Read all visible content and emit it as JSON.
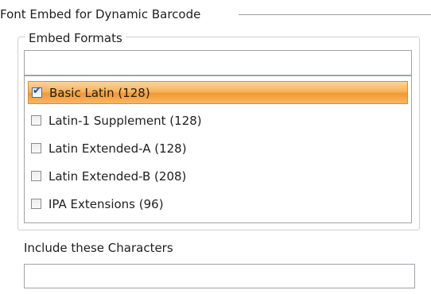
{
  "section": {
    "title": "Font Embed for Dynamic Barcode"
  },
  "embed_formats": {
    "group_title": "Embed Formats",
    "filter_value": "",
    "items": [
      {
        "label": "Basic Latin (128)",
        "checked": true,
        "selected": true
      },
      {
        "label": "Latin-1 Supplement (128)",
        "checked": false,
        "selected": false
      },
      {
        "label": "Latin Extended-A (128)",
        "checked": false,
        "selected": false
      },
      {
        "label": "Latin Extended-B (208)",
        "checked": false,
        "selected": false
      },
      {
        "label": "IPA Extensions (96)",
        "checked": false,
        "selected": false
      }
    ]
  },
  "include": {
    "label": "Include these Characters",
    "value": ""
  },
  "colors": {
    "selection_orange": "#f29a2e",
    "checkbox_blue": "#1f4fa0",
    "border_gray": "#9fa3a8"
  }
}
